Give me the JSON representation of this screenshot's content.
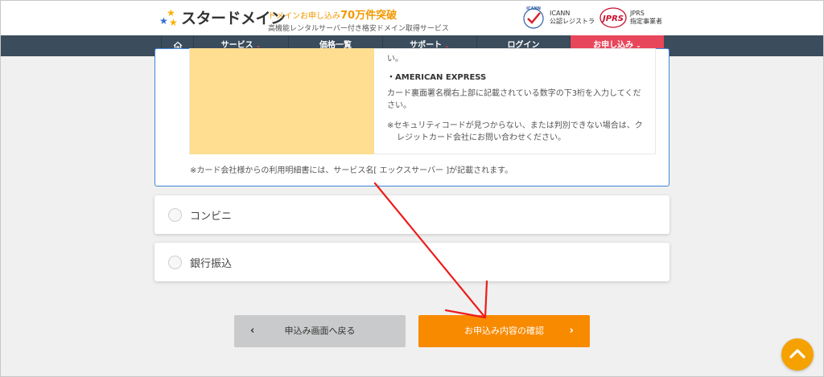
{
  "header": {
    "logo_text": "スタードメイン",
    "tagline_prefix": "ドメインお申し込み",
    "tagline_count": "70万件突破",
    "tagline_sub": "高機能レンタルサーバー付き格安ドメイン取得サービス",
    "icann": {
      "line1": "ICANN",
      "line2": "公認レジストラ",
      "logo_text": "ICANN"
    },
    "jprs": {
      "line1": "JPRS",
      "line2": "指定事業者",
      "logo_text": "JPRS"
    }
  },
  "nav": {
    "home_icon": "home-icon",
    "items": [
      {
        "label": "サービス"
      },
      {
        "label": "価格一覧"
      },
      {
        "label": "サポート"
      },
      {
        "label": "ログイン"
      },
      {
        "label": "お申し込み"
      }
    ],
    "chevron": "⌄",
    "accent_color": "#e8465a",
    "bg_color": "#3b4c5c"
  },
  "card": {
    "fragment": "い。",
    "amex_title": "・AMERICAN EXPRESS",
    "amex_desc": "カード裏面署名欄右上部に記載されている数字の下3桁を入力してください。",
    "amex_note": "※セキュリティコードが見つからない、または判別できない場合は、クレジットカード会社にお問い合わせください。",
    "statement_note": "※カード会社様からの利用明細書には、サービス名[ エックスサーバー ]が記載されます。"
  },
  "payment_options": [
    {
      "label": "コンビニ"
    },
    {
      "label": "銀行振込"
    }
  ],
  "buttons": {
    "back_label": "申込み画面へ戻る",
    "back_arrow": "‹",
    "confirm_label": "お申込み内容の確認",
    "confirm_arrow": "›",
    "confirm_color": "#f88a00"
  },
  "scroll_top_icon": "chevron-up-icon"
}
